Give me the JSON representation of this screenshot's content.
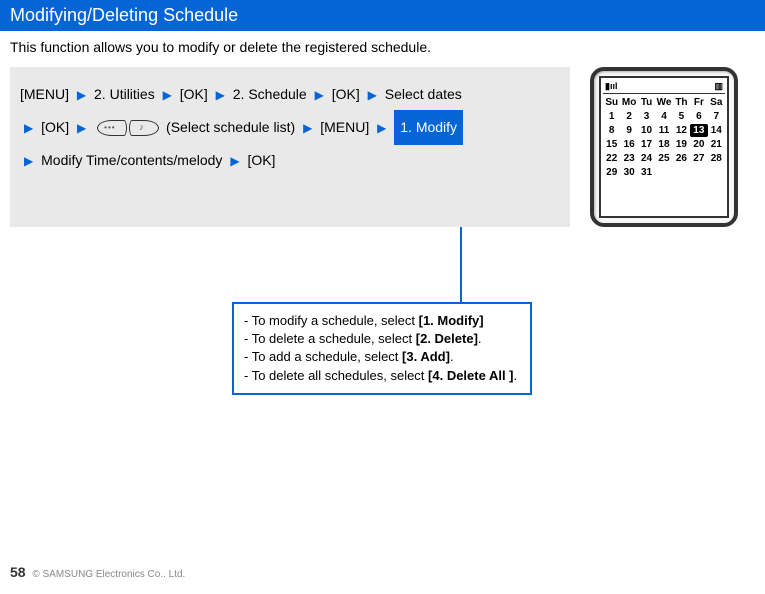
{
  "title": "Modifying/Deleting Schedule",
  "intro": "This function allows you to modify or delete the registered schedule.",
  "steps": {
    "menu": "[MENU]",
    "utilities": "2. Utilities",
    "ok1": "[OK]",
    "schedule": "2. Schedule",
    "ok2": "[OK]",
    "select_dates": "Select dates",
    "ok3": "[OK]",
    "select_list": "(Select schedule list)",
    "menu2": "[MENU]",
    "modify_badge": "1. Modify",
    "modify_time": "Modify Time/contents/melody",
    "ok4": "[OK]"
  },
  "callout": {
    "l1a": "- To modify a schedule, select ",
    "l1b": "[1. Modify]",
    "l2a": "- To delete a schedule, select ",
    "l2b": "[2. Delete]",
    "l2c": ".",
    "l3a": "- To add a schedule, select ",
    "l3b": "[3. Add]",
    "l3c": ".",
    "l4a": "- To delete all schedules, select ",
    "l4b": "[4. Delete All ]",
    "l4c": "."
  },
  "calendar": {
    "days": [
      "Su",
      "Mo",
      "Tu",
      "We",
      "Th",
      "Fr",
      "Sa"
    ],
    "rows": [
      [
        "1",
        "2",
        "3",
        "4",
        "5",
        "6",
        "7"
      ],
      [
        "8",
        "9",
        "10",
        "11",
        "12",
        "13",
        "14"
      ],
      [
        "15",
        "16",
        "17",
        "18",
        "19",
        "20",
        "21"
      ],
      [
        "22",
        "23",
        "24",
        "25",
        "26",
        "27",
        "28"
      ],
      [
        "29",
        "30",
        "31",
        "",
        "",
        "",
        ""
      ]
    ],
    "selected": "13"
  },
  "footer": {
    "page": "58",
    "copyright": "© SAMSUNG Electronics Co.. Ltd."
  }
}
